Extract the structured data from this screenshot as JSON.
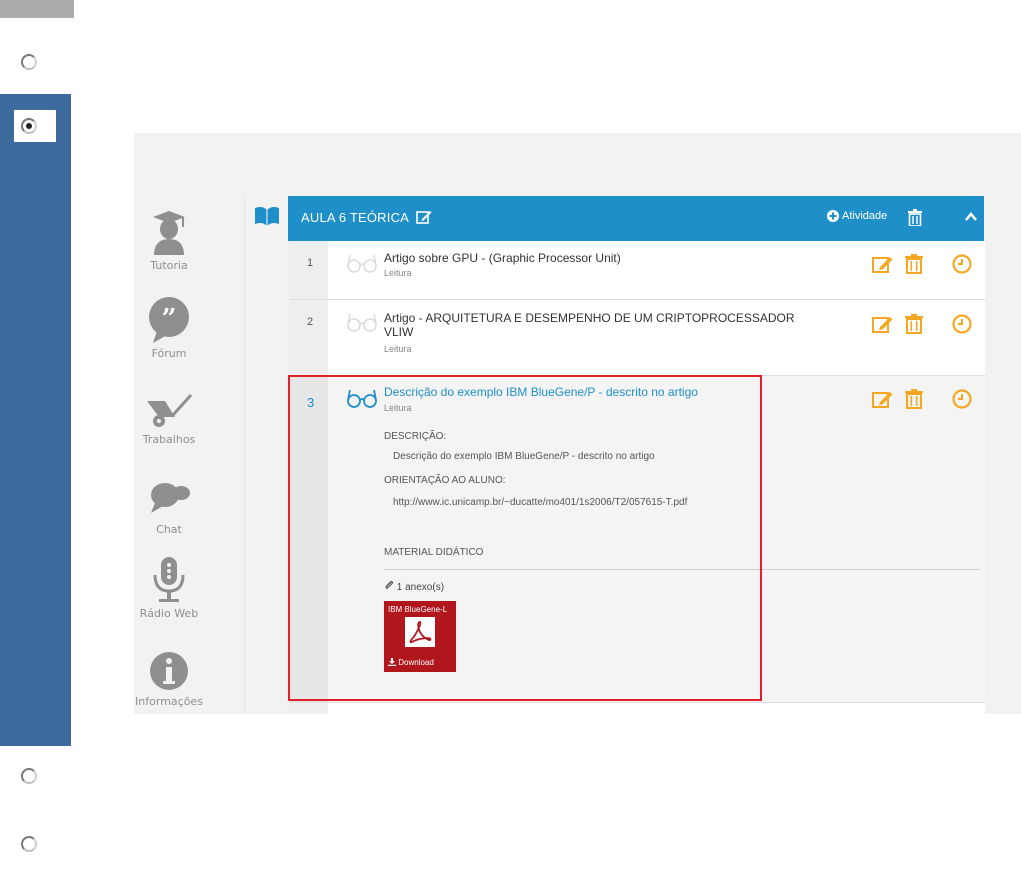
{
  "colors": {
    "accent": "#1e8fc9",
    "side_blue": "#3e6b9d",
    "action_orange": "#f5a623",
    "highlight_red": "#e0212b",
    "pdf_red": "#b0161c"
  },
  "sidebar_nav": {
    "items": [
      {
        "label": "Tutoria",
        "icon": "graduate-icon"
      },
      {
        "label": "Fórum",
        "icon": "quote-bubble-icon"
      },
      {
        "label": "Trabalhos",
        "icon": "wheelbarrow-icon"
      },
      {
        "label": "Chat",
        "icon": "chat-bubbles-icon"
      },
      {
        "label": "Rádio Web",
        "icon": "microphone-icon"
      },
      {
        "label": "Informações",
        "icon": "info-icon"
      }
    ]
  },
  "lesson": {
    "title": "AULA 6  TEÓRICA",
    "add_activity_label": "Atividade",
    "rows": [
      {
        "num": "1",
        "title": "Artigo sobre GPU - (Graphic Processor Unit)",
        "type": "Leitura"
      },
      {
        "num": "2",
        "title": "Artigo - ARQUITETURA E DESEMPENHO DE UM CRIPTOPROCESSADOR VLIW",
        "type": "Leitura"
      },
      {
        "num": "3",
        "title": "Descrição do exemplo IBM BlueGene/P - descrito no artigo",
        "type": "Leitura",
        "description_label": "DESCRIÇÃO:",
        "description": "Descrição do exemplo IBM BlueGene/P - descrito no artigo",
        "guidance_label": "ORIENTAÇÃO AO ALUNO:",
        "guidance": "http://www.ic.unicamp.br/~ducatte/mo401/1s2006/T2/057615-T.pdf",
        "material_label": "MATERIAL DIDÁTICO",
        "attachments_label": "1 anexo(s)",
        "attachment": {
          "name": "IBM BlueGene-L",
          "download_label": "Download"
        }
      }
    ]
  }
}
